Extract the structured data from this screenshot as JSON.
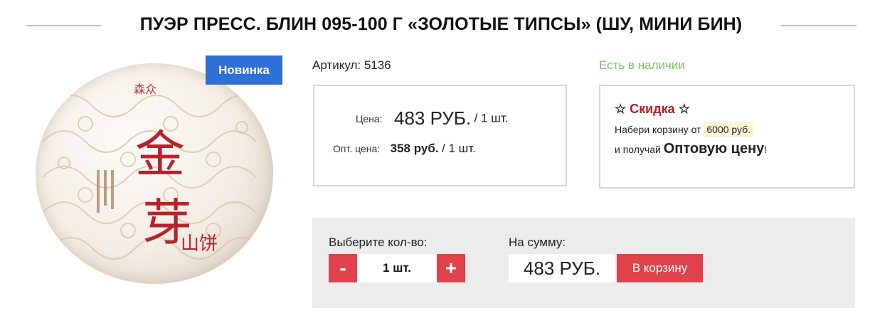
{
  "page": {
    "title": "ПУЭР ПРЕСС. БЛИН 095-100 Г «ЗОЛОТЫЕ ТИПСЫ» (ШУ, МИНИ БИН)"
  },
  "product": {
    "badge": "Новинка",
    "sku": "Артикул: 5136",
    "stock": "Есть в наличии",
    "colors": {
      "badge": "#2f6fd8",
      "stock": "#7fbf6a",
      "accent": "#e0424c",
      "discount": "#c0181c"
    }
  },
  "price": {
    "label": "Цена:",
    "value": "483 РУБ.",
    "unit": " / 1 шт.",
    "opt_label": "Опт. цена:",
    "opt_value": "358 руб.",
    "opt_unit": " / 1 шт."
  },
  "discount": {
    "star_left": "☆",
    "title": "Скидка",
    "star_right": "☆",
    "line1_prefix": "Набери корзину от ",
    "line1_amount": "6000 руб.",
    "line2_prefix": "и получай ",
    "line2_bold": "Оптовую цену",
    "line2_suffix": "!"
  },
  "purchase": {
    "qty_label": "Выберите кол-во:",
    "minus": "-",
    "qty_value": "1 шт.",
    "plus": "+",
    "sum_label": "На сумму:",
    "sum_value": "483 РУБ.",
    "cart_button": "В корзину"
  },
  "image": {
    "brand": "森众",
    "char_top": "金",
    "char_bottom": "芽",
    "char_small": "山饼"
  }
}
